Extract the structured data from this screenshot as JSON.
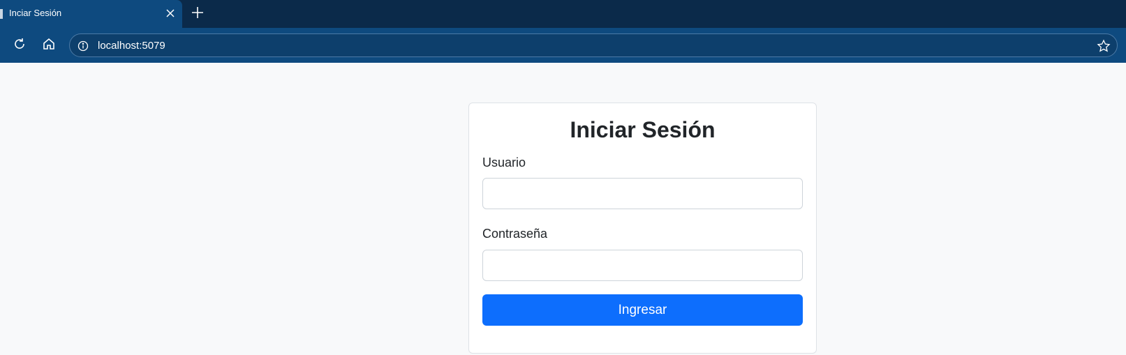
{
  "browser": {
    "tab": {
      "title": "Inciar Sesión"
    },
    "address_bar": {
      "url": "localhost:5079"
    },
    "icons": {
      "reload": "reload-icon",
      "home": "home-icon",
      "info": "info-icon",
      "star": "bookmark-star-icon",
      "close": "close-icon",
      "new_tab": "plus-icon"
    }
  },
  "login": {
    "title": "Iniciar Sesión",
    "username_label": "Usuario",
    "username_value": "",
    "password_label": "Contraseña",
    "password_value": "",
    "submit_label": "Ingresar"
  },
  "colors": {
    "tabbar": "#0b2a4a",
    "toolbar": "#0e4a7f",
    "page_background": "#f8f9fa",
    "primary_button": "#0d6efd"
  }
}
